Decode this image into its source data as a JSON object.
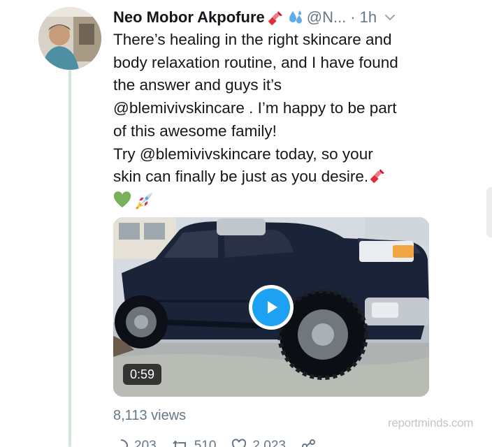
{
  "tweet": {
    "display_name": "Neo Mobor Akpofure",
    "handle": "@N...",
    "separator": "·",
    "time": "1h",
    "name_emojis": [
      "lipstick-icon",
      "sweat-droplets-icon"
    ],
    "text_lines": [
      "There’s healing in the right skincare and",
      "body relaxation routine, and I have found",
      "the answer and guys it’s",
      "@blemivivskincare . I’m happy to be part",
      "of this awesome family!",
      "Try @blemivivskincare today, so your",
      "skin can finally be just as you desire."
    ],
    "trailing_emojis": [
      "green-heart-icon",
      "rocket-icon"
    ],
    "video": {
      "duration": "0:59",
      "play_icon": "play-icon"
    },
    "views": "8,113 views",
    "actions": {
      "reply_count": "203",
      "retweet_count": "510",
      "like_count": "2,023"
    }
  },
  "watermark": "reportminds.com",
  "colors": {
    "accent": "#1da1f2",
    "text": "#14171a",
    "muted": "#657786",
    "thread_line": "#cfe9d9"
  }
}
